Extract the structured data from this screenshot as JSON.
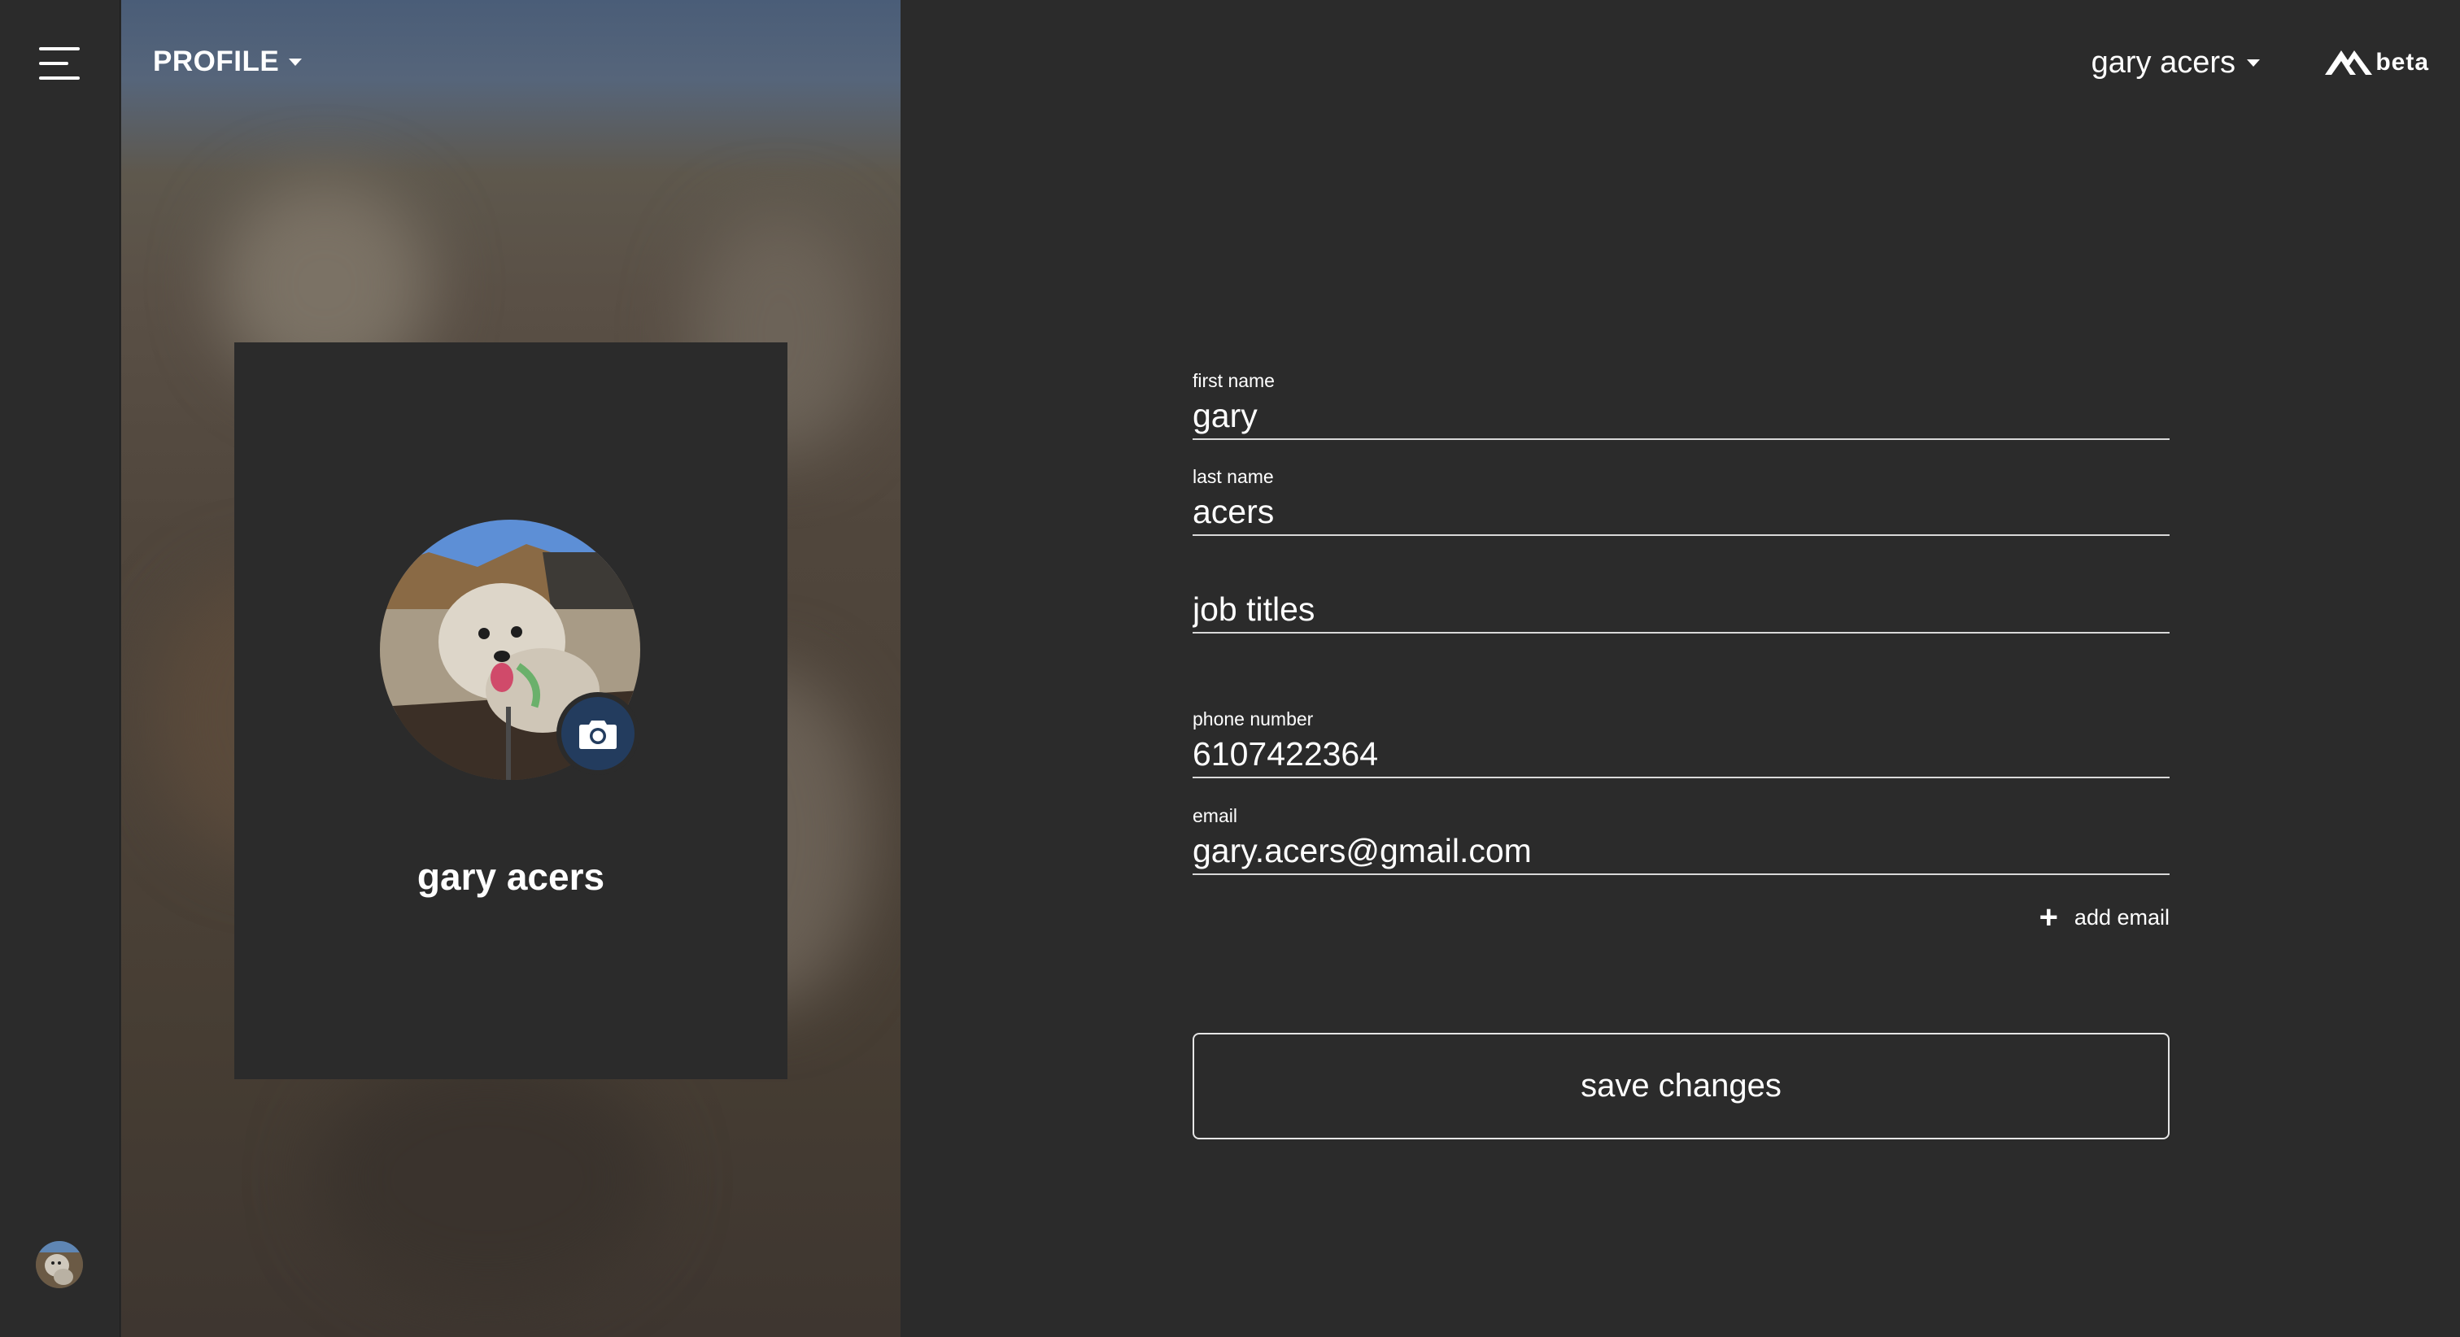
{
  "header": {
    "section_title": "PROFILE",
    "user_menu_label": "gary acers",
    "brand_label": "beta"
  },
  "profile_card": {
    "display_name": "gary acers"
  },
  "form": {
    "first_name": {
      "label": "first name",
      "value": "gary"
    },
    "last_name": {
      "label": "last name",
      "value": "acers"
    },
    "job_titles": {
      "placeholder": "job titles",
      "value": ""
    },
    "phone_number": {
      "label": "phone number",
      "value": "6107422364"
    },
    "email": {
      "label": "email",
      "value": "gary.acers@gmail.com"
    },
    "add_email_label": "add email",
    "save_label": "save changes"
  },
  "icons": {
    "menu": "hamburger-menu-icon",
    "camera": "camera-icon",
    "plus": "plus-icon",
    "dropdown": "caret-down-icon",
    "brand": "mountain-logo-icon"
  },
  "colors": {
    "background": "#2b2b2b",
    "camera_button": "#233c5e",
    "text": "#ffffff",
    "field_underline": "#d9d9d9"
  }
}
